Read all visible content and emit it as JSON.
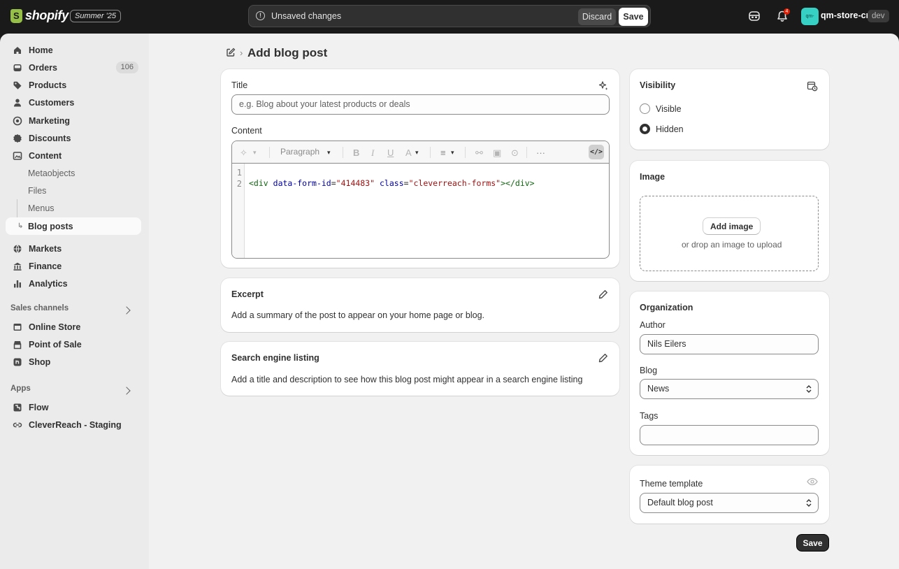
{
  "topbar": {
    "logo_text": "shopify",
    "edition": "Summer '25",
    "save_bar_message": "Unsaved changes",
    "discard_label": "Discard",
    "save_label": "Save",
    "notification_count": "4",
    "store_avatar_text": "qm-",
    "store_name": "qm-store-cr",
    "store_tag": "dev"
  },
  "sidebar": {
    "items": [
      {
        "label": "Home",
        "icon": "home-icon"
      },
      {
        "label": "Orders",
        "icon": "inbox-icon",
        "badge": "106"
      },
      {
        "label": "Products",
        "icon": "tag-icon"
      },
      {
        "label": "Customers",
        "icon": "person-icon"
      },
      {
        "label": "Marketing",
        "icon": "target-icon"
      },
      {
        "label": "Discounts",
        "icon": "discount-icon"
      },
      {
        "label": "Content",
        "icon": "content-icon"
      }
    ],
    "content_sub": [
      "Metaobjects",
      "Files",
      "Menus",
      "Blog posts"
    ],
    "items2": [
      {
        "label": "Markets",
        "icon": "globe-icon"
      },
      {
        "label": "Finance",
        "icon": "bank-icon"
      },
      {
        "label": "Analytics",
        "icon": "chart-icon"
      }
    ],
    "sales_channels_label": "Sales channels",
    "sales_channels": [
      {
        "label": "Online Store",
        "icon": "store-icon"
      },
      {
        "label": "Point of Sale",
        "icon": "pos-icon"
      },
      {
        "label": "Shop",
        "icon": "shop-icon"
      }
    ],
    "apps_label": "Apps",
    "apps": [
      {
        "label": "Flow",
        "icon": "flow-icon"
      },
      {
        "label": "CleverReach - Staging",
        "icon": "link-icon"
      }
    ]
  },
  "page": {
    "title": "Add blog post"
  },
  "main_card": {
    "title_label": "Title",
    "title_placeholder": "e.g. Blog about your latest products or deals",
    "content_label": "Content",
    "paragraph_label": "Paragraph",
    "line_numbers": [
      "1",
      "2"
    ],
    "code": {
      "tag_open": "<div",
      "attr1": "data-form-id",
      "eq1": "=",
      "val1": "\"414483\"",
      "attr2": "class",
      "eq2": "=",
      "val2": "\"cleverreach-forms\"",
      "tag_close": "></div>"
    }
  },
  "excerpt": {
    "title": "Excerpt",
    "description": "Add a summary of the post to appear on your home page or blog."
  },
  "seo": {
    "title": "Search engine listing",
    "description": "Add a title and description to see how this blog post might appear in a search engine listing"
  },
  "visibility": {
    "title": "Visibility",
    "options": [
      "Visible",
      "Hidden"
    ],
    "selected": "Hidden"
  },
  "image": {
    "title": "Image",
    "add_label": "Add image",
    "hint": "or drop an image to upload"
  },
  "organization": {
    "title": "Organization",
    "author_label": "Author",
    "author_value": "Nils Eilers",
    "blog_label": "Blog",
    "blog_value": "News",
    "tags_label": "Tags",
    "tags_value": ""
  },
  "theme": {
    "title": "Theme template",
    "value": "Default blog post"
  },
  "footer": {
    "save_label": "Save"
  }
}
